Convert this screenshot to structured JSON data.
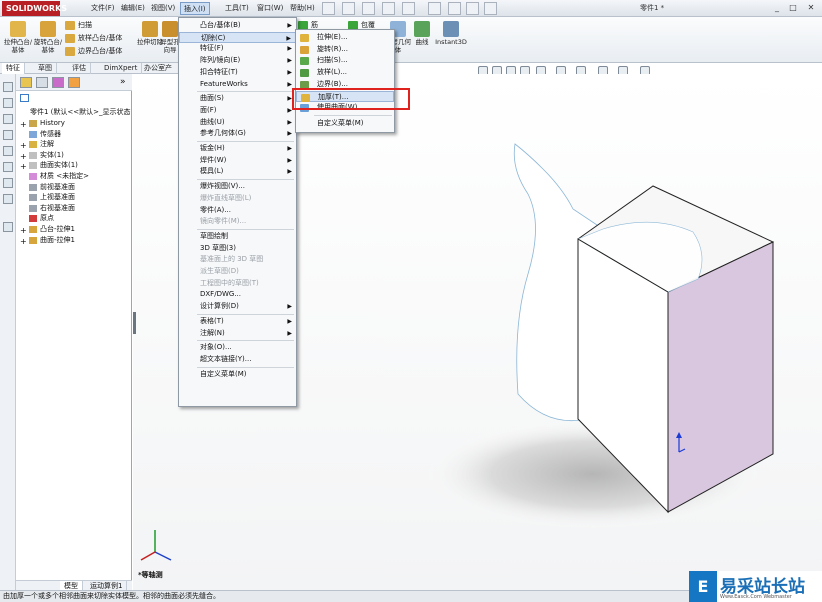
{
  "app": {
    "logo_text": "SOLIDWORKS",
    "doc_title": "零件1 *",
    "menus": [
      "文件(F)",
      "编辑(E)",
      "视图(V)",
      "插入(I)",
      "工具(T)",
      "窗口(W)",
      "帮助(H)"
    ],
    "active_menu": "插入(I)",
    "window_controls": [
      "_",
      "□",
      "✕"
    ]
  },
  "command_manager": {
    "large_buttons": [
      {
        "label": "拉伸凸台/基体"
      },
      {
        "label": "旋转凸台/基体"
      },
      {
        "label": "拉伸切除"
      },
      {
        "label": "异型孔向导"
      }
    ],
    "small_buttons": [
      "扫描",
      "放样凸台/基体",
      "边界凸台/基体"
    ],
    "right_buttons": [
      {
        "label": "筋"
      },
      {
        "label": "包覆"
      },
      {
        "label": "参考几何体"
      },
      {
        "label": "曲线"
      },
      {
        "label": "Instant3D"
      }
    ]
  },
  "tabs": [
    "特征",
    "草图",
    "评估",
    "DimXpert",
    "办公室产品"
  ],
  "feature_tree": {
    "root": "零件1 (默认<<默认>_显示状态",
    "items": [
      {
        "label": "History",
        "expand": "+"
      },
      {
        "label": "传感器",
        "expand": ""
      },
      {
        "label": "注解",
        "expand": "+"
      },
      {
        "label": "实体(1)",
        "expand": "+"
      },
      {
        "label": "曲面实体(1)",
        "expand": "+"
      },
      {
        "label": "材质 <未指定>",
        "expand": ""
      },
      {
        "label": "前视基准面",
        "expand": ""
      },
      {
        "label": "上视基准面",
        "expand": ""
      },
      {
        "label": "右视基准面",
        "expand": ""
      },
      {
        "label": "原点",
        "expand": ""
      },
      {
        "label": "凸台-拉伸1",
        "expand": "+"
      },
      {
        "label": "曲面-拉伸1",
        "expand": "+"
      }
    ]
  },
  "insert_menu": {
    "items": [
      {
        "label": "凸台/基体(B)",
        "submenu": true,
        "disabled": false
      },
      {
        "label": "切除(C)",
        "submenu": true,
        "disabled": false,
        "highlighted": true
      },
      {
        "label": "特征(F)",
        "submenu": true,
        "disabled": false
      },
      {
        "label": "阵列/镜向(E)",
        "submenu": true,
        "disabled": false
      },
      {
        "label": "扣合特征(T)",
        "submenu": true,
        "disabled": false
      },
      {
        "label": "FeatureWorks",
        "submenu": true,
        "disabled": false
      },
      {
        "sep": true
      },
      {
        "label": "曲面(S)",
        "submenu": true,
        "disabled": false
      },
      {
        "label": "面(F)",
        "submenu": true,
        "disabled": false
      },
      {
        "label": "曲线(U)",
        "submenu": true,
        "disabled": false
      },
      {
        "label": "参考几何体(G)",
        "submenu": true,
        "disabled": false
      },
      {
        "sep": true
      },
      {
        "label": "钣金(H)",
        "submenu": true,
        "disabled": false
      },
      {
        "label": "焊件(W)",
        "submenu": true,
        "disabled": false
      },
      {
        "label": "模具(L)",
        "submenu": true,
        "disabled": false
      },
      {
        "sep": true
      },
      {
        "label": "爆炸视图(V)...",
        "submenu": false,
        "disabled": false
      },
      {
        "label": "爆炸直线草图(L)",
        "submenu": false,
        "disabled": true
      },
      {
        "label": "零件(A)...",
        "submenu": false,
        "disabled": false
      },
      {
        "label": "镜向零件(M)...",
        "submenu": false,
        "disabled": true
      },
      {
        "sep": true
      },
      {
        "label": "草图绘制",
        "submenu": false,
        "disabled": false
      },
      {
        "label": "3D 草图(3)",
        "submenu": false,
        "disabled": false
      },
      {
        "label": "基准面上的 3D 草图",
        "submenu": false,
        "disabled": true
      },
      {
        "label": "派生草图(D)",
        "submenu": false,
        "disabled": true
      },
      {
        "label": "工程图中的草图(T)",
        "submenu": false,
        "disabled": true
      },
      {
        "label": "DXF/DWG...",
        "submenu": false,
        "disabled": false
      },
      {
        "label": "设计算例(D)",
        "submenu": true,
        "disabled": false
      },
      {
        "sep": true
      },
      {
        "label": "表格(T)",
        "submenu": true,
        "disabled": false
      },
      {
        "label": "注解(N)",
        "submenu": true,
        "disabled": false
      },
      {
        "sep": true
      },
      {
        "label": "对象(O)...",
        "submenu": false,
        "disabled": false
      },
      {
        "label": "超文本链接(Y)...",
        "submenu": false,
        "disabled": false
      },
      {
        "sep": true
      },
      {
        "label": "自定义菜单(M)",
        "submenu": false,
        "disabled": false
      }
    ]
  },
  "cut_submenu": {
    "items": [
      {
        "label": "拉伸(E)..."
      },
      {
        "label": "旋转(R)..."
      },
      {
        "label": "扫描(S)..."
      },
      {
        "label": "放样(L)..."
      },
      {
        "label": "边界(B)..."
      },
      {
        "label": "加厚(T)...",
        "highlighted": true
      },
      {
        "label": "使用曲面(W)..."
      },
      {
        "sep": true
      },
      {
        "label": "自定义菜单(M)"
      }
    ]
  },
  "bottom_tabs": [
    "模型",
    "运动算例1"
  ],
  "view_label": "*等轴测",
  "status_text": "由加厚一个或多个相邻曲面来切除实体模型。相邻的曲面必须先缝合。",
  "watermark": {
    "logo": "E",
    "text": "易采站长站",
    "sub": "Www.Easck.Com Webmaster"
  },
  "colors": {
    "accent": "#1577c4",
    "highlight_box": "#e0221f",
    "box_side": "#d9c6df"
  }
}
